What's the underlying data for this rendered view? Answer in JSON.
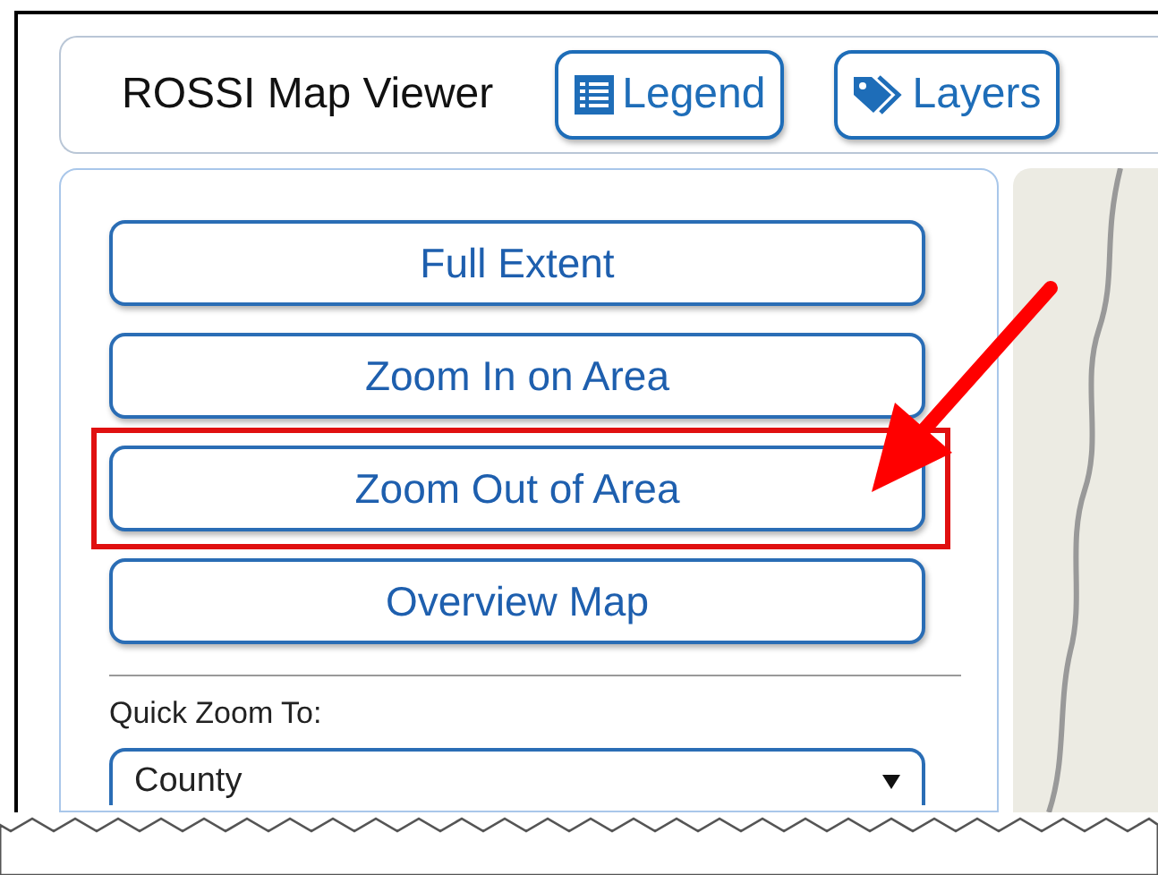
{
  "header": {
    "title": "ROSSI Map Viewer",
    "buttons": [
      {
        "label": "Legend",
        "kind": "legend"
      },
      {
        "label": "Layers",
        "kind": "layers"
      }
    ]
  },
  "tools": [
    {
      "label": "Full Extent",
      "highlighted": false
    },
    {
      "label": "Zoom In on Area",
      "highlighted": false
    },
    {
      "label": "Zoom Out of Area",
      "highlighted": true
    },
    {
      "label": "Overview Map",
      "highlighted": false
    }
  ],
  "quick_zoom": {
    "label": "Quick Zoom To:",
    "value": "County"
  }
}
